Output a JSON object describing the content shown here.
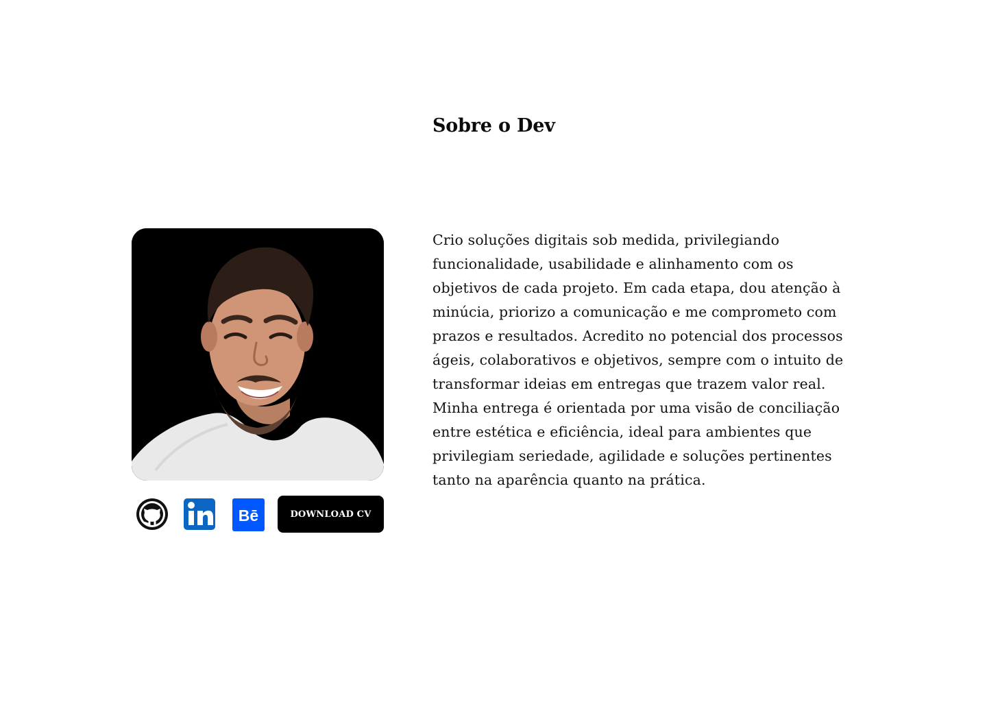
{
  "section": {
    "title": "Sobre o Dev"
  },
  "profile": {
    "photo_icon": "profile-photo"
  },
  "social": {
    "github_icon": "github-icon",
    "linkedin_icon": "linkedin-icon",
    "behance_icon": "behance-icon",
    "behance_label": "Bē",
    "download_label": "DOWNLOAD CV"
  },
  "bio": {
    "lines": [
      "Crio soluções digitais sob medida, privilegiando",
      "funcionalidade, usabilidade e alinhamento com os",
      "objetivos de cada projeto. Em cada etapa, dou atenção à",
      "minúcia, priorizo a comunicação e me comprometo com",
      "prazos e resultados. Acredito no potencial dos processos",
      "ágeis, colaborativos e objetivos, sempre com o intuito de",
      "transformar ideias em entregas que trazem valor real.",
      "Minha entrega é orientada por uma visão de conciliação",
      "entre estética e eficiência, ideal para ambientes que",
      "privilegiam seriedade, agilidade e soluções pertinentes",
      "tanto na aparência quanto na prática."
    ]
  },
  "colors": {
    "text": "#111111",
    "button_background": "#000000",
    "button_text": "#ffffff",
    "linkedin": "#0a66c2",
    "behance": "#0057ff"
  }
}
